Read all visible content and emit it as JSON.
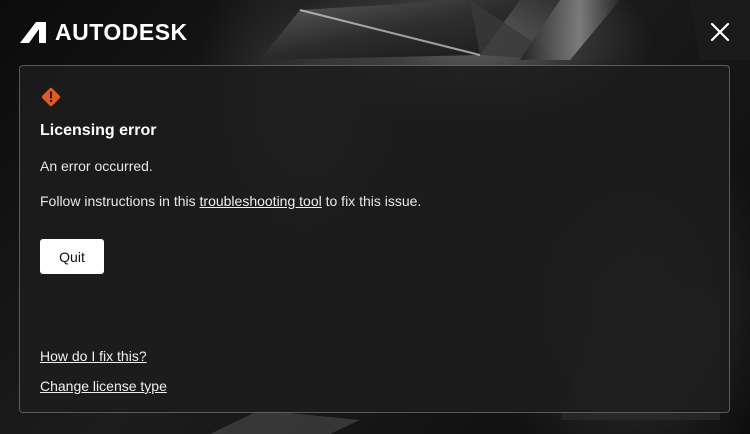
{
  "brand": {
    "name": "AUTODESK",
    "logo_icon": "autodesk-logo-icon"
  },
  "window": {
    "close_icon": "close-icon"
  },
  "dialog": {
    "status_icon": "warning-diamond-icon",
    "title": "Licensing error",
    "message": "An error occurred.",
    "instruction_prefix": "Follow instructions in this ",
    "instruction_link": "troubleshooting tool",
    "instruction_suffix": " to fix this issue.",
    "quit_label": "Quit",
    "help_link": "How do I fix this?",
    "license_link": "Change license type"
  },
  "colors": {
    "warning": "#e25a22",
    "background": "#0b0b0b",
    "panel": "#1c1c1c",
    "button": "#ffffff"
  }
}
